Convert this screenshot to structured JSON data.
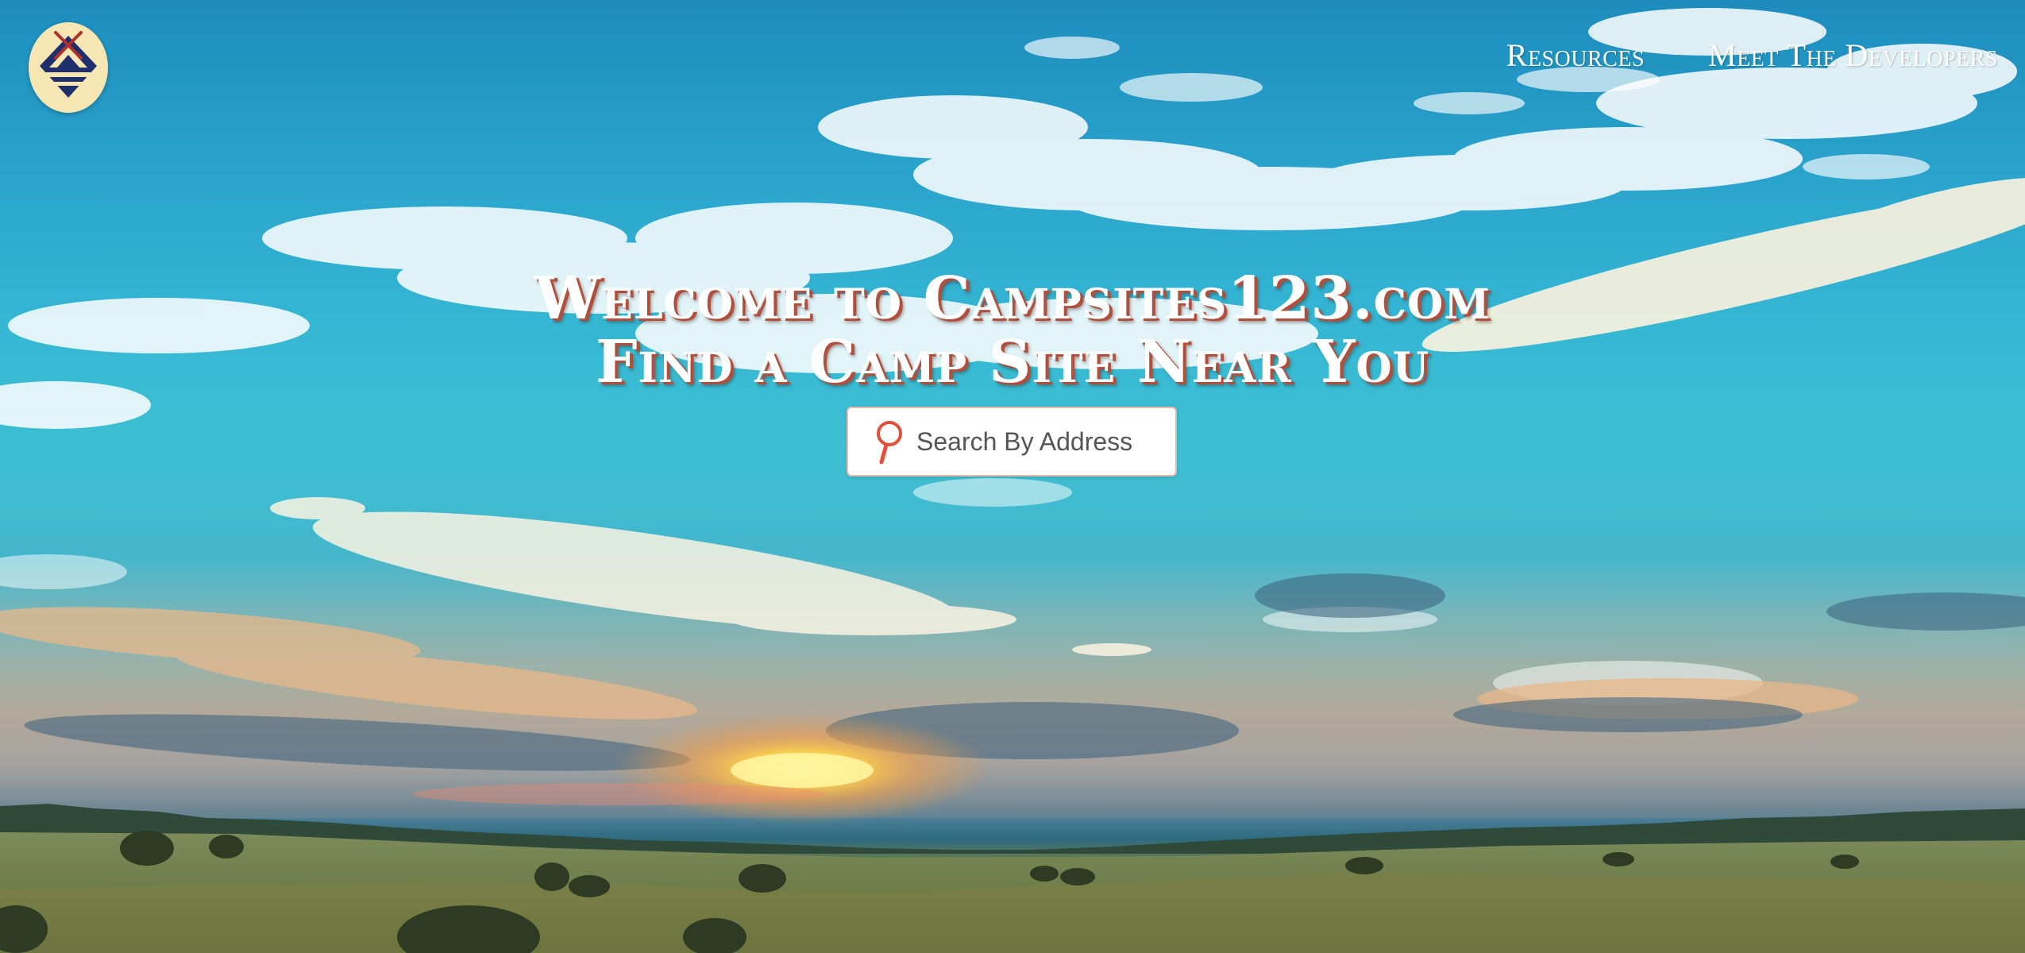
{
  "header": {
    "logo_icon": "tent-diamond-logo-icon",
    "nav": [
      {
        "label": "Resources"
      },
      {
        "label": "Meet The Developers"
      }
    ]
  },
  "hero": {
    "line1": "Welcome to Campsites123.com",
    "line2": "Find a Camp Site Near You"
  },
  "search": {
    "icon": "search-icon",
    "placeholder": "Search By Address",
    "value": ""
  },
  "colors": {
    "title_shadow": "#b0503c",
    "logo_background": "#f6e6b4",
    "logo_navy": "#1f2f6b",
    "logo_red": "#b0302c",
    "search_icon": "#e0503a"
  }
}
